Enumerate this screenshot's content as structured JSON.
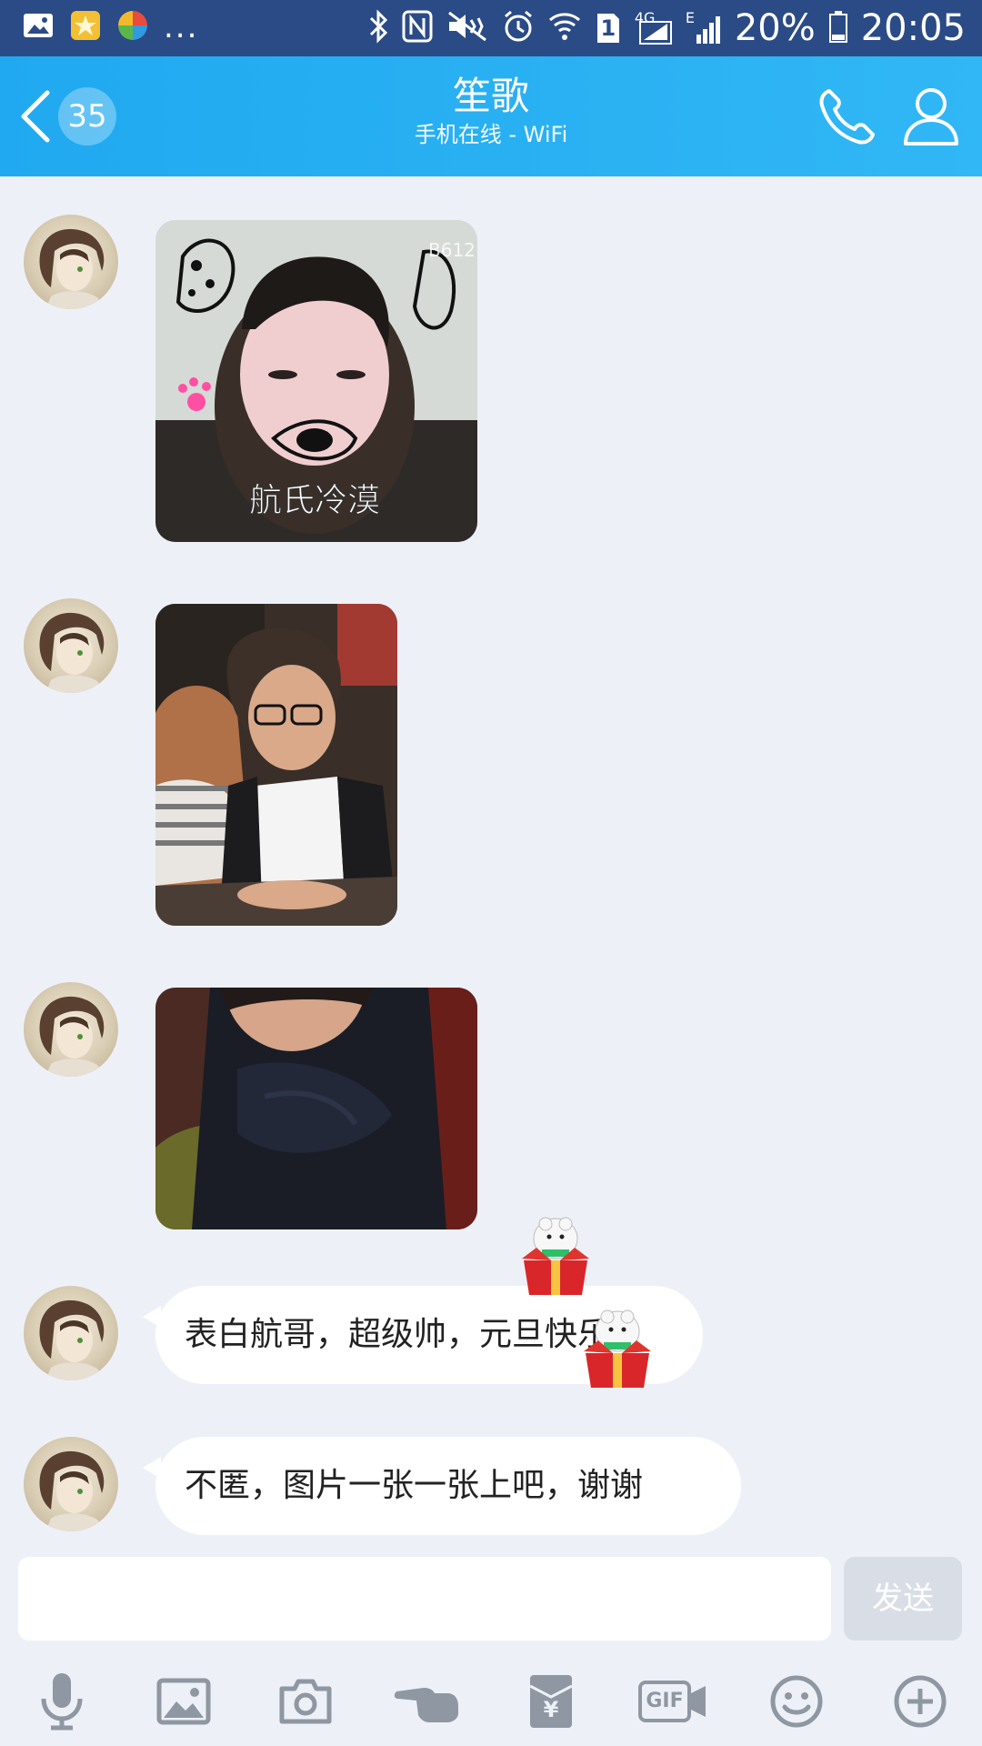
{
  "status_bar": {
    "notification_more": "...",
    "battery_text": "20%",
    "time": "20:05",
    "network_label": "4G",
    "edge_label": "E",
    "sim_label": "1",
    "icons": [
      "gallery-icon",
      "star-badge-icon",
      "app-icon",
      "bluetooth-icon",
      "nfc-icon",
      "mute-icon",
      "alarm-icon",
      "wifi-icon",
      "sim-icon",
      "signal-icon",
      "battery-icon"
    ]
  },
  "header": {
    "unread_count": "35",
    "title": "笙歌",
    "subtitle": "手机在线 - WiFi",
    "accent": "#2cb2f3"
  },
  "messages": [
    {
      "type": "image",
      "caption": "航氏冷漠",
      "corner_tag": "B612"
    },
    {
      "type": "image"
    },
    {
      "type": "image"
    },
    {
      "type": "text",
      "text": "表白航哥，超级帅，元旦快乐"
    },
    {
      "type": "text",
      "text": "不匿，图片一张一张上吧，谢谢"
    }
  ],
  "input": {
    "placeholder": "",
    "send_label": "发送"
  },
  "toolbar": {
    "items": [
      "microphone-icon",
      "image-icon",
      "camera-icon",
      "poke-icon",
      "red-packet-icon",
      "gif-icon",
      "emoji-icon",
      "plus-icon"
    ],
    "gif_label": "GIF",
    "yuan_label": "¥"
  }
}
